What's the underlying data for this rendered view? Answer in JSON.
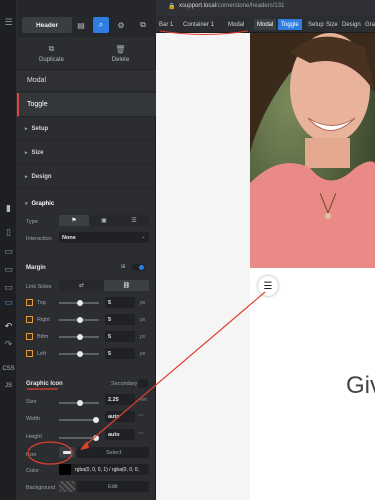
{
  "rail": {
    "label_css": "CSS",
    "label_js": "JS"
  },
  "toolbar": {
    "header_label": "Header"
  },
  "actions": {
    "duplicate": "Duplicate",
    "delete": "Delete"
  },
  "nav": {
    "modal": "Modal",
    "toggle": "Toggle"
  },
  "sections": {
    "setup": "Setup",
    "size": "Size",
    "design": "Design",
    "graphic": "Graphic",
    "margin": "Margin",
    "graphic_icon": "Graphic Icon",
    "secondary": "Secondary"
  },
  "graphic": {
    "type_label": "Type",
    "interaction_label": "Interaction",
    "interaction_value": "None"
  },
  "margin": {
    "link_sides_label": "Link Sides",
    "rows": [
      {
        "label": "Top",
        "value": "5",
        "unit": "px"
      },
      {
        "label": "Right",
        "value": "5",
        "unit": "px"
      },
      {
        "label": "Bttm",
        "value": "5",
        "unit": "px"
      },
      {
        "label": "Left",
        "value": "5",
        "unit": "px"
      }
    ]
  },
  "graphic_icon": {
    "size_label": "Size",
    "size_value": "2.25",
    "size_unit": "em",
    "width_label": "Width",
    "width_value": "auto",
    "height_label": "Height",
    "height_value": "auto",
    "icon_label": "Icon",
    "icon_select": "Select",
    "color_label": "Color",
    "color_value": "rgba(0, 0, 0, 1) / rgba(0, 0, 0,",
    "background_label": "Background",
    "background_value": "Edit"
  },
  "browser": {
    "url_host": "xsupport.local",
    "url_path": "/cornerstone/headers/131"
  },
  "breadcrumbs": [
    "Bar 1",
    "Container 1",
    "Modal"
  ],
  "crumb_tabs": [
    "Modal",
    "Toggle",
    "Setup",
    "Size",
    "Design",
    "Gra"
  ],
  "preview": {
    "text": "Giv"
  },
  "colors": {
    "accent": "#2f7de1",
    "annotation": "#e0402e"
  }
}
